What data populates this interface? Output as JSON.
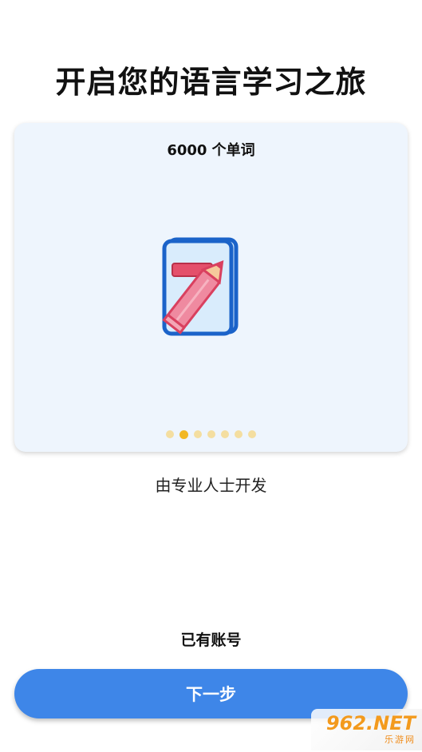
{
  "header": {
    "title": "开启您的语言学习之旅"
  },
  "card": {
    "caption": "6000 个单词",
    "illustration_icon": "notebook-pencil-icon",
    "pagination": {
      "total": 7,
      "active_index": 1
    }
  },
  "subtitle": "由专业人士开发",
  "actions": {
    "login_label": "已有账号",
    "next_label": "下一步"
  },
  "watermark": {
    "main": "962.NET",
    "sub": "乐游网"
  },
  "colors": {
    "primary": "#3e86e8",
    "card_bg": "#eef5fd",
    "dot_active": "#f2b824",
    "dot_inactive": "#f4dea0"
  }
}
